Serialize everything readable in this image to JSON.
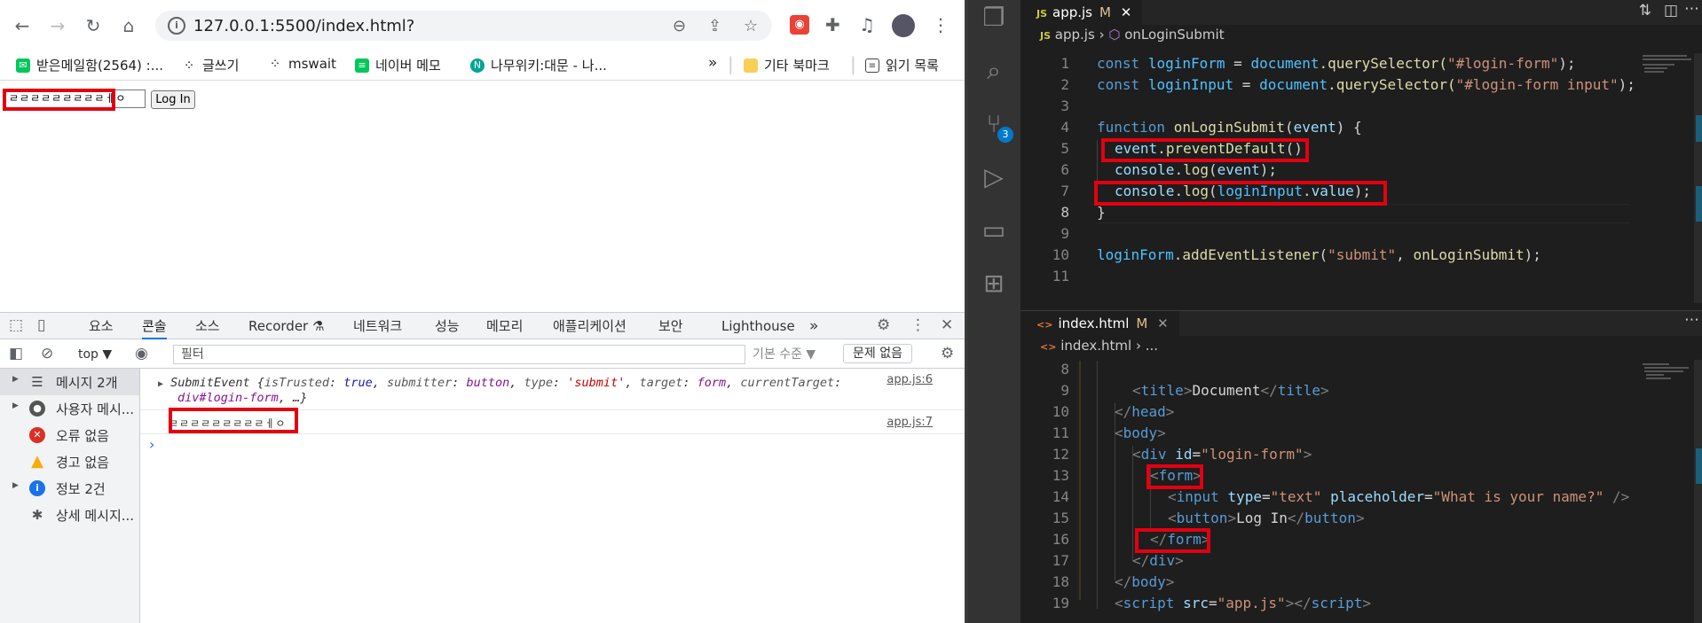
{
  "browser": {
    "url": "127.0.0.1:5500/index.html?",
    "bookmarks": [
      "받은메일함(2564) :...",
      "글쓰기",
      "mswait",
      "네이버 메모",
      "나무위키:대문 - 나...",
      "»",
      "기타 북마크",
      "읽기 목록"
    ],
    "page": {
      "input_value": "ㄹㄹㄹㄹㄹㄹㄹㄹㄹㅔㅇ",
      "login_button": "Log In"
    }
  },
  "devtools": {
    "tabs": [
      "요소",
      "콘솔",
      "소스",
      "Recorder ⚗",
      "네트워크",
      "성능",
      "메모리",
      "애플리케이션",
      "보안",
      "Lighthouse",
      "»"
    ],
    "active_tab": "콘솔",
    "context": "top ▼",
    "filter_placeholder": "필터",
    "level": "기본 수준 ▼",
    "issues": "문제 없음",
    "sidebar": [
      {
        "label": "메시지 2개",
        "icon": "list-icon"
      },
      {
        "label": "사용자 메시...",
        "icon": "user-icon"
      },
      {
        "label": "오류 없음",
        "icon": "error-icon"
      },
      {
        "label": "경고 없음",
        "icon": "warning-icon"
      },
      {
        "label": "정보 2건",
        "icon": "info-icon"
      },
      {
        "label": "상세 메시지...",
        "icon": "bug-icon"
      }
    ],
    "messages": [
      {
        "source": "app.js:6",
        "event_name": "SubmitEvent",
        "p1": "isTrusted",
        "v1": "true",
        "p2": "submitter",
        "v2": "button",
        "p3": "type",
        "v3": "'submit'",
        "p4": "target",
        "v4": "form",
        "p5": "currentTarget",
        "v5": "div#login-form",
        "tail": "…}"
      },
      {
        "source": "app.js:7",
        "text": "ㄹㄹㄹㄹㄹㄹㄹㄹㄹㅔㅇ"
      }
    ],
    "prompt": "›"
  },
  "vscode": {
    "top_tab": {
      "lang": "JS",
      "name": "app.js",
      "modified": "M"
    },
    "top_crumb": {
      "file": "app.js",
      "symbol": "onLoginSubmit"
    },
    "bottom_tab": {
      "lang": "<>",
      "name": "index.html",
      "modified": "M"
    },
    "bottom_crumb": {
      "file": "index.html",
      "rest": "..."
    },
    "scm_badge": "3",
    "js_lines": [
      "1",
      "2",
      "3",
      "4",
      "5",
      "6",
      "7",
      "8",
      "9",
      "10",
      "11"
    ],
    "js": {
      "l1": [
        "const",
        "loginForm",
        "=",
        "document",
        ".querySelector(",
        "\"#login-form\"",
        ");"
      ],
      "l2": [
        "const",
        "loginInput",
        "=",
        "document",
        ".querySelector(",
        "\"#login-form input\"",
        ");"
      ],
      "l4": [
        "function",
        "onLoginSubmit",
        "(",
        "event",
        ") {"
      ],
      "l5": [
        "event",
        ".",
        "preventDefault",
        "();"
      ],
      "l6": [
        "console",
        ".",
        "log",
        "(",
        "event",
        ");"
      ],
      "l7": [
        "console",
        ".",
        "log",
        "(",
        "loginInput",
        ".",
        "value",
        ");"
      ],
      "l8": [
        "}"
      ],
      "l10": [
        "loginForm",
        ".",
        "addEventListener",
        "(",
        "\"submit\"",
        ", ",
        "onLoginSubmit",
        ");"
      ]
    },
    "html_lines": [
      "8",
      "9",
      "10",
      "11",
      "12",
      "13",
      "14",
      "15",
      "16",
      "17",
      "18",
      "19"
    ],
    "html": {
      "l9": [
        "<",
        "title",
        ">",
        "Document",
        "</",
        "title",
        ">"
      ],
      "l10": [
        "</",
        "head",
        ">"
      ],
      "l11": [
        "<",
        "body",
        ">"
      ],
      "l12": [
        "<",
        "div",
        " ",
        "id",
        "=",
        "\"login-form\"",
        ">"
      ],
      "l13": [
        "<",
        "form",
        ">"
      ],
      "l14": [
        "<",
        "input",
        " ",
        "type",
        "=",
        "\"text\"",
        " ",
        "placeholder",
        "=",
        "\"What is your name?\"",
        " />"
      ],
      "l15": [
        "<",
        "button",
        ">",
        "Log In",
        "</",
        "button",
        ">"
      ],
      "l16": [
        "</",
        "form",
        ">"
      ],
      "l17": [
        "</",
        "div",
        ">"
      ],
      "l18": [
        "</",
        "body",
        ">"
      ],
      "l19": [
        "<",
        "script",
        " ",
        "src",
        "=",
        "\"app.js\"",
        "></",
        "script",
        ">"
      ]
    }
  },
  "colors": {
    "highlight": "#e30010",
    "vscode_bg": "#1e1e1e",
    "accent": "#1a73e8"
  }
}
